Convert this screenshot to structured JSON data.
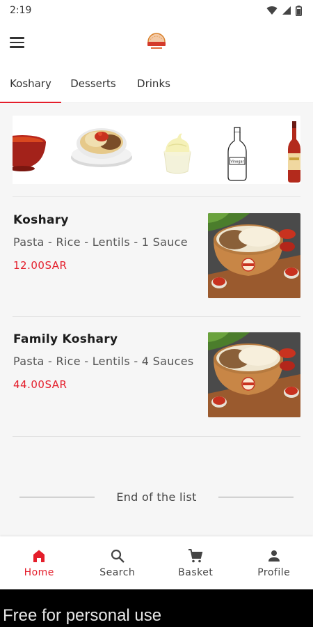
{
  "status_bar": {
    "time": "2:19",
    "icons": [
      "wifi-icon",
      "signal-icon",
      "battery-icon"
    ]
  },
  "app_bar": {
    "menu_icon": "hamburger-menu-icon",
    "logo": "brand-logo"
  },
  "tabs": [
    {
      "label": "Koshary",
      "active": true
    },
    {
      "label": "Desserts",
      "active": false
    },
    {
      "label": "Drinks",
      "active": false
    }
  ],
  "banner": {
    "items": [
      "sauce-bowl",
      "koshary-plate",
      "ice-cream-cup",
      "vinegar-bottle",
      "drink-bottle"
    ],
    "vinegar_label": "Vinegar"
  },
  "products": [
    {
      "name": "Koshary",
      "description": "Pasta - Rice - Lentils - 1 Sauce",
      "price": "12.00SAR"
    },
    {
      "name": "Family Koshary",
      "description": "Pasta - Rice - Lentils - 4 Sauces",
      "price": "44.00SAR"
    }
  ],
  "end_of_list": "End of the list",
  "bottom_nav": [
    {
      "label": "Home",
      "icon": "home-icon",
      "active": true
    },
    {
      "label": "Search",
      "icon": "search-icon",
      "active": false
    },
    {
      "label": "Basket",
      "icon": "cart-icon",
      "active": false
    },
    {
      "label": "Profile",
      "icon": "person-icon",
      "active": false
    }
  ],
  "footer": {
    "text": "Free for personal use"
  },
  "colors": {
    "accent": "#e41e2b",
    "background": "#f6f6f6"
  }
}
